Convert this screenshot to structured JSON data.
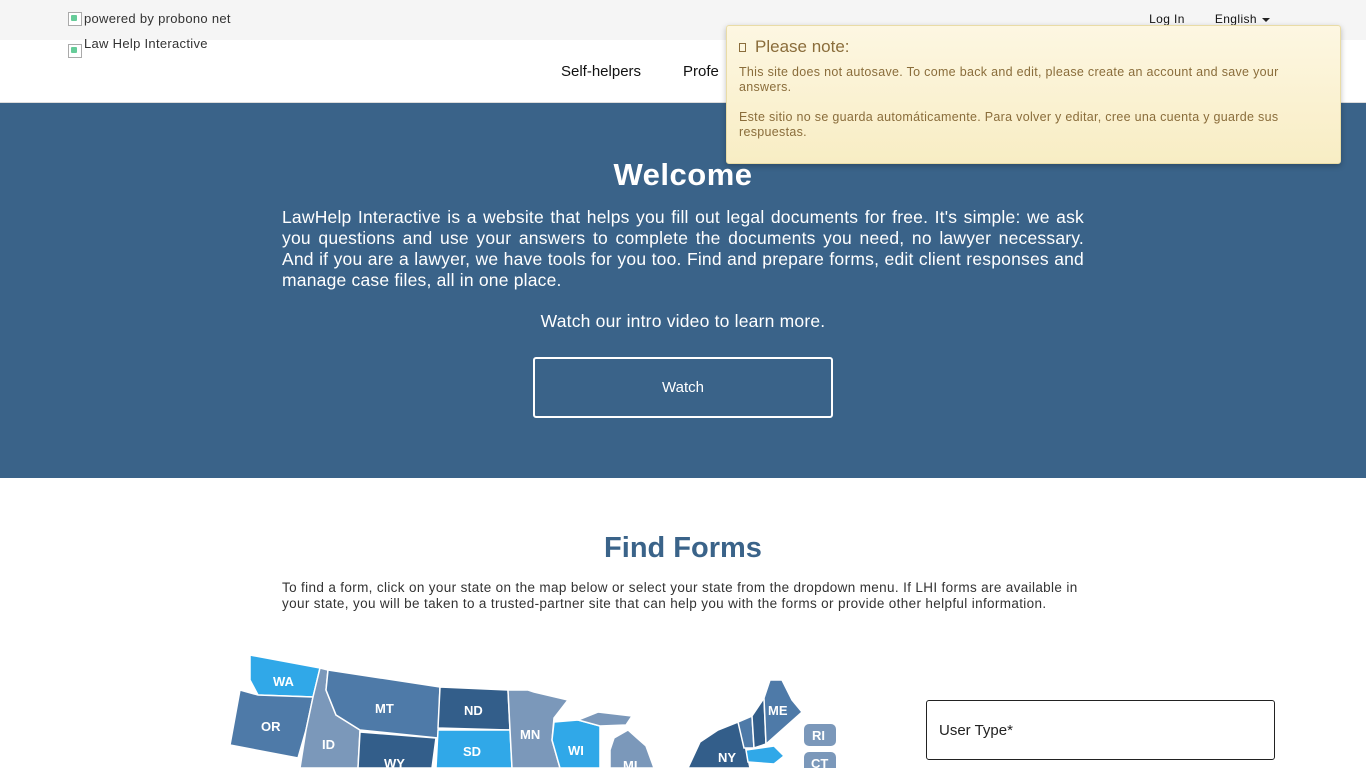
{
  "topbar": {
    "powered_by": "powered by probono net",
    "login": "Log In",
    "language": "English"
  },
  "navbar": {
    "logo_alt": "Law Help Interactive",
    "items": [
      "Self-helpers",
      "Profe"
    ]
  },
  "hero": {
    "title": "Welcome",
    "text": "LawHelp Interactive is a website that helps you fill out legal documents for free. It's simple: we ask you questions and use your answers to complete the documents you need, no lawyer necessary. And if you are a lawyer, we have tools for you too. Find and prepare forms, edit client responses and manage case files, all in one place.",
    "subtext": "Watch our intro video to learn more.",
    "watch_label": "Watch"
  },
  "find_forms": {
    "title": "Find Forms",
    "text": "To find a form, click on your state on the map below or select your state from the dropdown menu. If LHI forms are available in your state, you will be taken to a trusted-partner site that can help you with the forms or provide other helpful information.",
    "user_type_label": "User Type*"
  },
  "map": {
    "states": [
      "WA",
      "OR",
      "ID",
      "MT",
      "WY",
      "ND",
      "SD",
      "MN",
      "WI",
      "MI",
      "NY",
      "ME",
      "RI",
      "CT"
    ]
  },
  "notice": {
    "title": "Please note:",
    "text_en": "This site does not autosave. To come back and edit, please create an account and save your answers.",
    "text_es": "Este sitio no se guarda automáticamente. Para volver y editar, cree una cuenta y guarde sus respuestas."
  },
  "colors": {
    "hero_bg": "#3a6389",
    "state_light": "#30a8e8",
    "state_mid": "#4e7aa8",
    "state_dark": "#335e8a",
    "state_gray": "#7b98ba",
    "notice_text": "#8a6d3b"
  }
}
